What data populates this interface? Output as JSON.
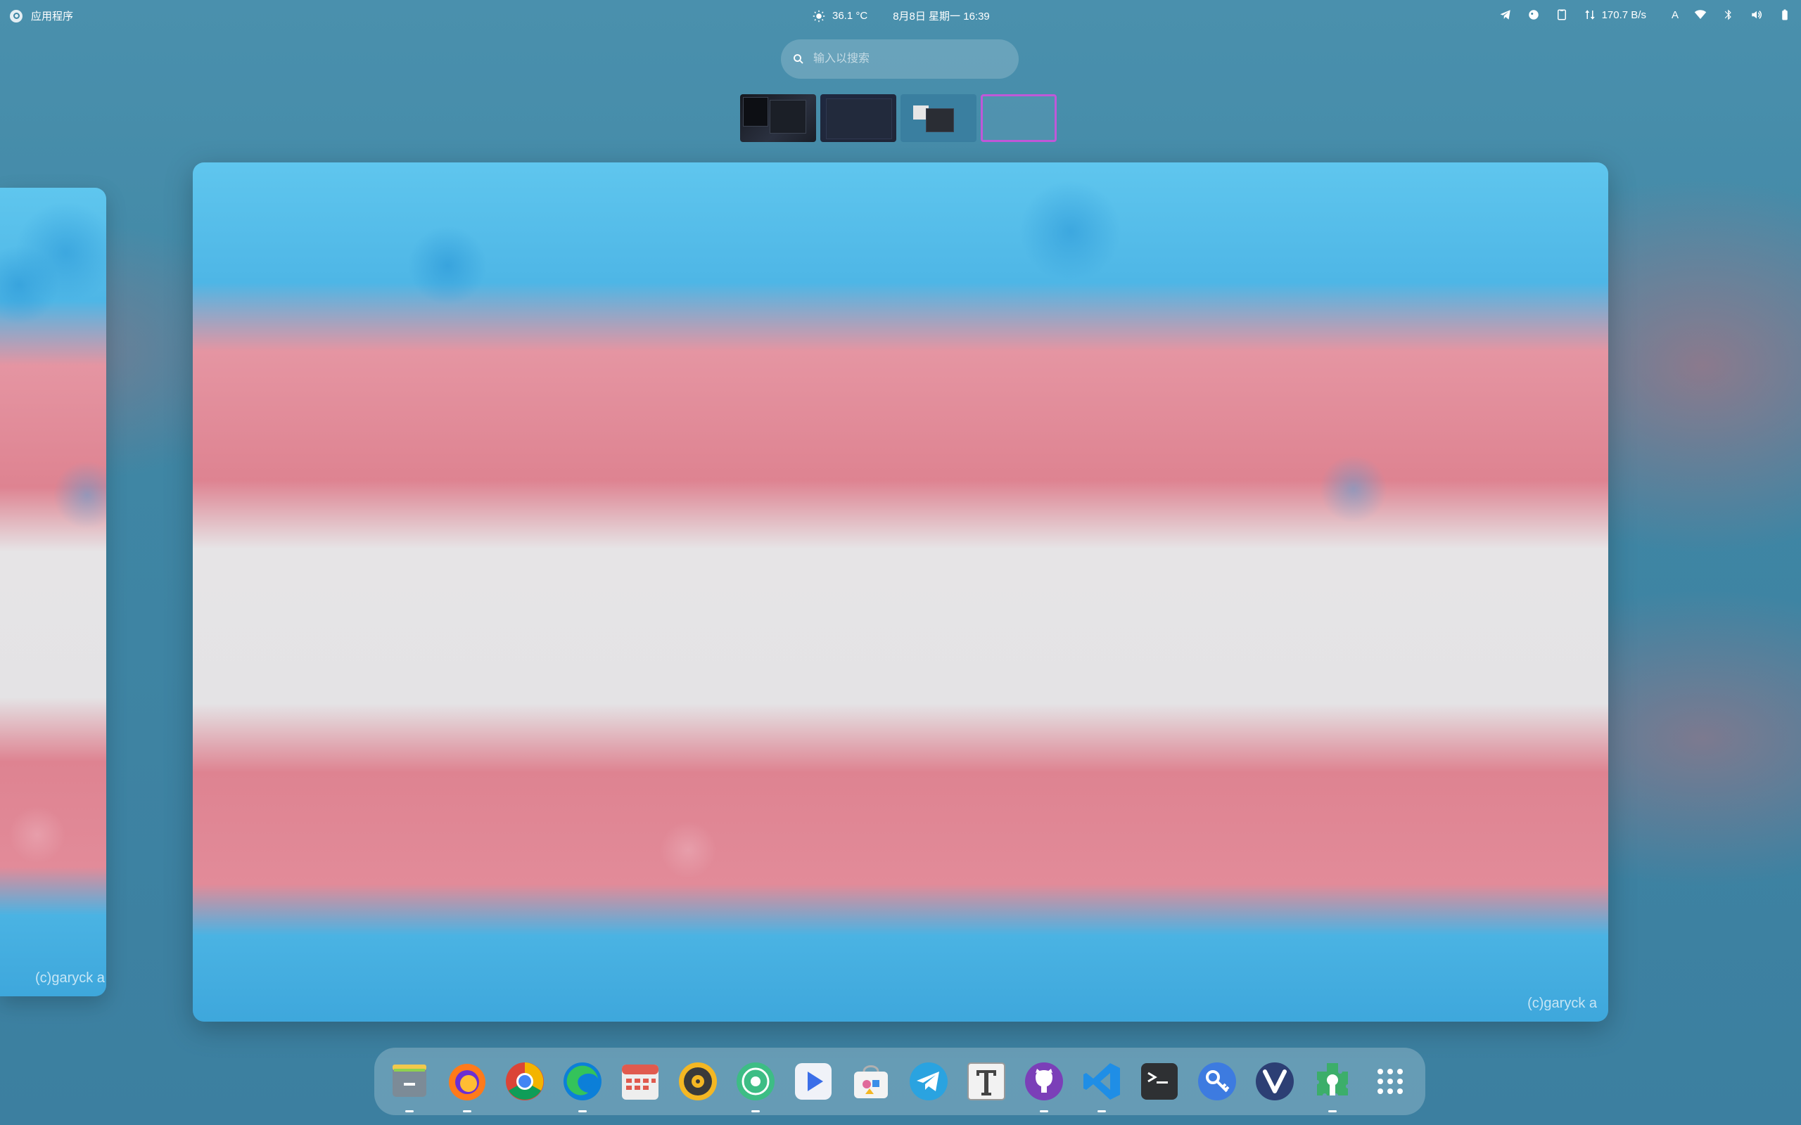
{
  "topbar": {
    "apps_label": "应用程序",
    "weather": "36.1 °C",
    "datetime": "8月8日 星期一  16:39",
    "net_speed": "170.7 B/s",
    "input_method": "A"
  },
  "search": {
    "placeholder": "输入以搜索"
  },
  "workspaces": {
    "count": 4,
    "active_index": 3
  },
  "window": {
    "watermark": "(c)garyck a"
  },
  "left_window": {
    "watermark": "(c)garyck a"
  },
  "dock": {
    "apps": [
      {
        "name": "files",
        "icon": "files-icon",
        "running": true
      },
      {
        "name": "firefox",
        "icon": "firefox-icon",
        "running": true
      },
      {
        "name": "chrome",
        "icon": "chrome-icon",
        "running": false
      },
      {
        "name": "edge",
        "icon": "edge-icon",
        "running": true
      },
      {
        "name": "calendar",
        "icon": "calendar-icon",
        "running": false
      },
      {
        "name": "rhythmbox",
        "icon": "music-player-icon",
        "running": false
      },
      {
        "name": "spotify-alt",
        "icon": "disc-icon",
        "running": true
      },
      {
        "name": "videos",
        "icon": "video-player-icon",
        "running": false
      },
      {
        "name": "software",
        "icon": "software-store-icon",
        "running": false
      },
      {
        "name": "telegram",
        "icon": "telegram-icon",
        "running": false
      },
      {
        "name": "typora",
        "icon": "typora-icon",
        "running": false
      },
      {
        "name": "github-desktop",
        "icon": "github-icon",
        "running": true
      },
      {
        "name": "vscode",
        "icon": "vscode-icon",
        "running": true
      },
      {
        "name": "terminal",
        "icon": "terminal-icon",
        "running": false
      },
      {
        "name": "passwords",
        "icon": "key-icon",
        "running": false
      },
      {
        "name": "vivaldi",
        "icon": "vivaldi-icon",
        "running": false
      },
      {
        "name": "extension-manager",
        "icon": "puzzle-icon",
        "running": true
      },
      {
        "name": "show-apps",
        "icon": "app-grid-icon",
        "running": false
      }
    ]
  }
}
